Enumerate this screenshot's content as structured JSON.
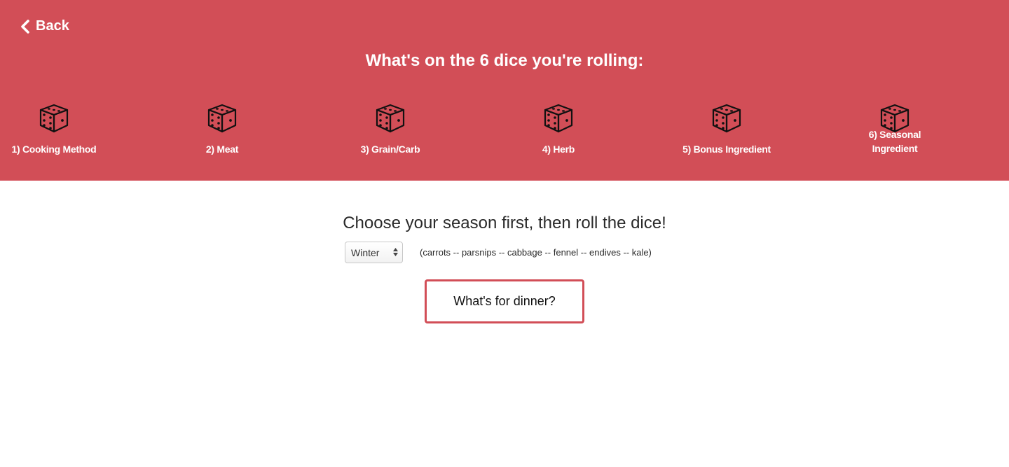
{
  "header": {
    "back_label": "Back",
    "back_icon": "chevron-left-icon",
    "title": "What's on the 6 dice you're rolling:",
    "background_color": "#d24e57"
  },
  "dice": [
    {
      "label": "1) Cooking Method",
      "icon": "die-icon"
    },
    {
      "label": "2) Meat",
      "icon": "die-icon"
    },
    {
      "label": "3) Grain/Carb",
      "icon": "die-icon"
    },
    {
      "label": "4) Herb",
      "icon": "die-icon"
    },
    {
      "label": "5) Bonus Ingredient",
      "icon": "die-icon"
    },
    {
      "label": "6) Seasonal Ingredient",
      "icon": "die-icon"
    }
  ],
  "main": {
    "heading": "Choose your season first, then roll the dice!",
    "season_select": {
      "selected": "Winter"
    },
    "season_veggies": "(carrots -- parsnips -- cabbage -- fennel -- endives -- kale)",
    "roll_button_label": "What's for dinner?",
    "accent_color": "#d24e57"
  }
}
